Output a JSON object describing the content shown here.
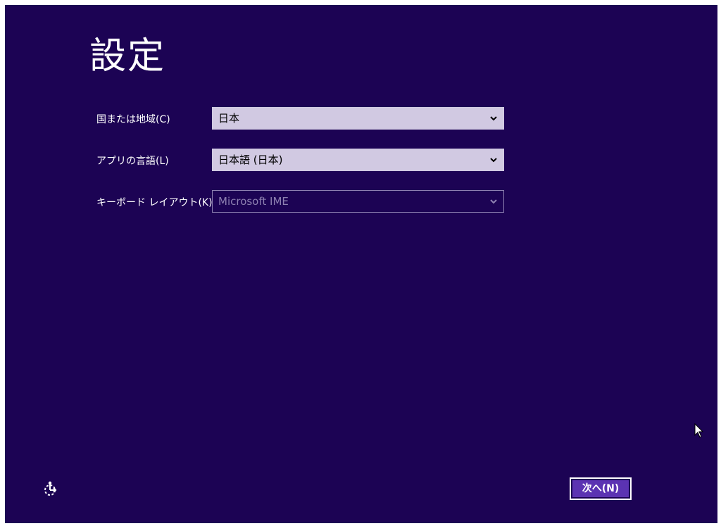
{
  "page": {
    "title": "設定"
  },
  "form": {
    "country": {
      "label": "国または地域(C)",
      "value": "日本",
      "enabled": true
    },
    "app_language": {
      "label": "アプリの言語(L)",
      "value": "日本語 (日本)",
      "enabled": true
    },
    "keyboard_layout": {
      "label": "キーボード レイアウト(K)",
      "value": "Microsoft IME",
      "enabled": false
    }
  },
  "footer": {
    "ease_of_access_icon": "ease-of-access-icon",
    "next_label": "次へ(N)"
  },
  "colors": {
    "background": "#1c0354",
    "combo_enabled_bg": "#d1c9e2",
    "combo_disabled_border": "#8d80b1",
    "button_fill": "#5b33b2"
  }
}
